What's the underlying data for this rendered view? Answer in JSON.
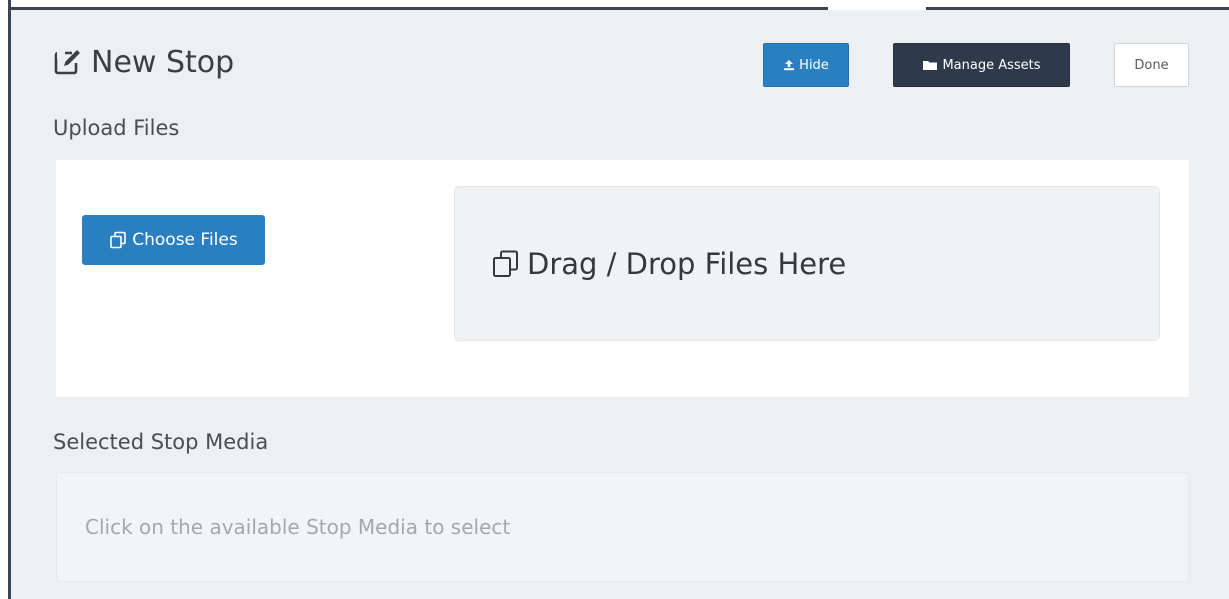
{
  "header": {
    "title": "New Stop",
    "title_icon": "edit-icon"
  },
  "toolbar": {
    "hide_label": "Hide",
    "hide_icon": "upload-icon",
    "manage_assets_label": "Manage Assets",
    "manage_assets_icon": "folder-icon",
    "done_label": "Done"
  },
  "upload": {
    "section_label": "Upload Files",
    "choose_files_label": "Choose Files",
    "choose_files_icon": "files-icon",
    "drop_zone_label": "Drag / Drop Files Here",
    "drop_zone_icon": "files-icon"
  },
  "selected_media": {
    "section_label": "Selected Stop Media",
    "placeholder": "Click on the available Stop Media to select"
  },
  "colors": {
    "primary": "#2a7fc0",
    "dark": "#2e3a4b",
    "panel_bg": "#edf0f2"
  }
}
